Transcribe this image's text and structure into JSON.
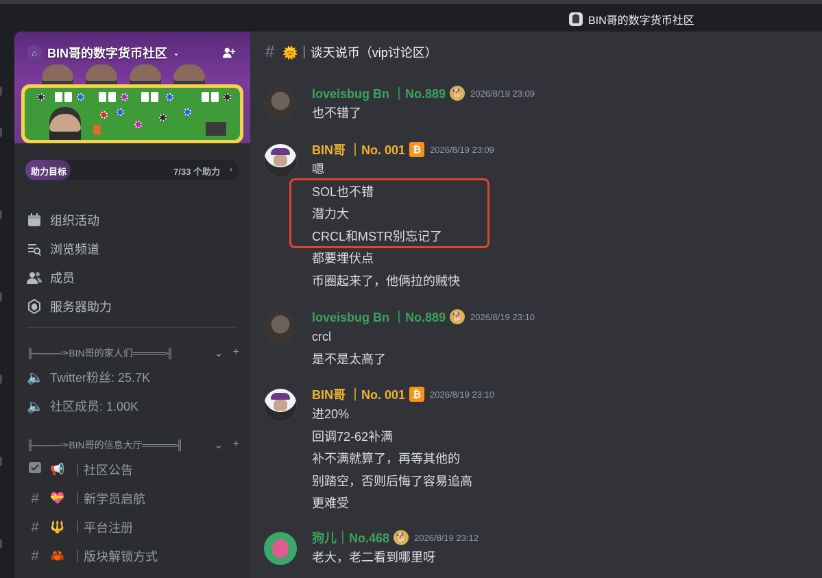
{
  "window": {
    "title": "BIN哥的数字货币社区"
  },
  "sidebar": {
    "server_name": "BIN哥的数字货币社区",
    "boost": {
      "label": "助力目标",
      "count": "7/33 个助力",
      "progress": 0.21
    },
    "menu": [
      {
        "label": "组织活动",
        "icon": "calendar-icon"
      },
      {
        "label": "浏览频道",
        "icon": "channel-list-icon"
      },
      {
        "label": "成员",
        "icon": "members-icon"
      },
      {
        "label": "服务器助力",
        "icon": "boost-gem-icon"
      }
    ],
    "categories": [
      {
        "name": "╟────✑BIN哥的家人们═════╢",
        "channels": [
          {
            "label": "Twitter粉丝: 25.7K",
            "icon": "voice-locked-icon",
            "emoji": ""
          },
          {
            "label": "社区成员: 1.00K",
            "icon": "voice-locked-icon",
            "emoji": ""
          }
        ]
      },
      {
        "name": "╟────✑BIN哥的信息大厅═════╢",
        "channels": [
          {
            "label": "｜社区公告",
            "icon": "announcement-icon",
            "emoji": "📢"
          },
          {
            "label": "｜新学员启航",
            "icon": "hash-icon",
            "emoji": "💝"
          },
          {
            "label": "｜平台注册",
            "icon": "hash-icon",
            "emoji": "🔱"
          },
          {
            "label": "｜版块解锁方式",
            "icon": "hash-icon",
            "emoji": "🦀"
          }
        ]
      }
    ]
  },
  "channel": {
    "name": "🌞｜谈天说币（vip讨论区）"
  },
  "messages": [
    {
      "author": "loveisbug Bn ｜No.889",
      "badge": "doge-coin-icon",
      "time": "2026/8/19 23:09",
      "lines": [
        "也不错了"
      ]
    },
    {
      "author": "BIN哥 ｜No. 001",
      "badge": "bitcoin-icon",
      "time": "2026/8/19 23:09",
      "lines": [
        "嗯",
        "SOL也不错",
        "潜力大",
        "CRCL和MSTR别忘记了",
        "都要埋伏点",
        "币圈起来了，他俩拉的贼快"
      ]
    },
    {
      "author": "loveisbug Bn ｜No.889",
      "badge": "doge-coin-icon",
      "time": "2026/8/19 23:10",
      "lines": [
        "crcl",
        "是不是太高了"
      ]
    },
    {
      "author": "BIN哥 ｜No. 001",
      "badge": "bitcoin-icon",
      "time": "2026/8/19 23:10",
      "lines": [
        "进20%",
        "回调72-62补满",
        "补不满就算了，再等其他的",
        "别踏空，否则后悔了容易追高",
        "更难受"
      ]
    },
    {
      "author": "狗儿｜No.468",
      "badge": "doge-coin-icon",
      "time": "2026/8/19 23:12",
      "lines": [
        "老大，老二看到哪里呀"
      ]
    }
  ],
  "colors": {
    "accent_green": "#3ba55c",
    "accent_gold": "#f0b232",
    "highlight_red": "#e0452c"
  }
}
